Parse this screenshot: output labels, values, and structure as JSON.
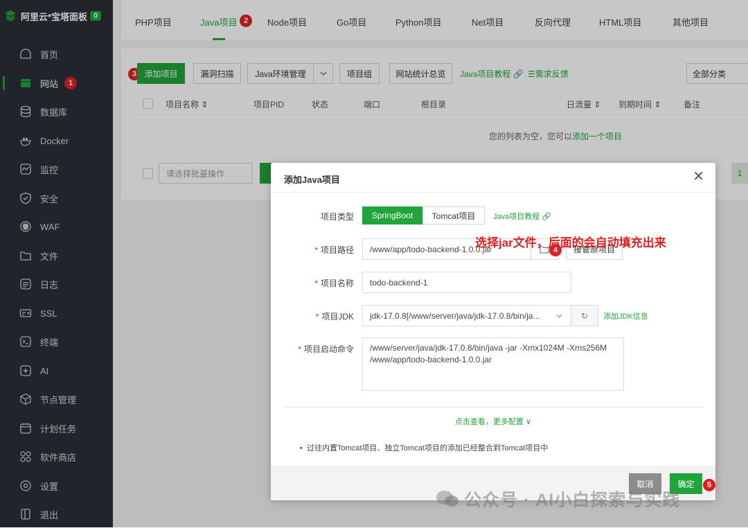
{
  "sidebar": {
    "brand": "阿里云*宝塔面板",
    "brand_count": "0",
    "items": [
      {
        "label": "首页",
        "icon": "home-icon"
      },
      {
        "label": "网站",
        "icon": "website-icon",
        "badge": "1"
      },
      {
        "label": "数据库",
        "icon": "database-icon"
      },
      {
        "label": "Docker",
        "icon": "docker-icon"
      },
      {
        "label": "监控",
        "icon": "monitor-icon"
      },
      {
        "label": "安全",
        "icon": "shield-icon"
      },
      {
        "label": "WAF",
        "icon": "waf-icon"
      },
      {
        "label": "文件",
        "icon": "folder-icon"
      },
      {
        "label": "日志",
        "icon": "log-icon"
      },
      {
        "label": "SSL",
        "icon": "ssl-icon"
      },
      {
        "label": "终端",
        "icon": "terminal-icon"
      },
      {
        "label": "AI",
        "icon": "ai-icon"
      },
      {
        "label": "节点管理",
        "icon": "node-icon"
      },
      {
        "label": "计划任务",
        "icon": "calendar-icon"
      },
      {
        "label": "软件商店",
        "icon": "store-icon"
      },
      {
        "label": "设置",
        "icon": "gear-icon"
      },
      {
        "label": "退出",
        "icon": "logout-icon"
      }
    ]
  },
  "tabs": [
    "PHP项目",
    "Java项目",
    "Node项目",
    "Go项目",
    "Python项目",
    "Net项目",
    "反向代理",
    "HTML项目",
    "其他项目"
  ],
  "tab_badge": "2",
  "toolbar": {
    "add_project": "添加项目",
    "add_badge": "3",
    "vuln_scan": "漏洞扫描",
    "java_env": "Java环境管理",
    "project_group": "项目组",
    "site_stats": "网站统计总览",
    "java_tutorial": "Java项目教程",
    "feedback": "需求反馈",
    "category": "全部分类"
  },
  "table": {
    "headers": [
      "项目名称",
      "项目PID",
      "状态",
      "端口",
      "根目录",
      "日流量",
      "到期时间",
      "备注"
    ],
    "empty_text": "您的列表为空，您可以",
    "empty_link": "添加一个项目",
    "batch_placeholder": "请选择批量操作",
    "page_num": "1"
  },
  "dialog": {
    "title": "添加Java项目",
    "type_label": "项目类型",
    "type_springboot": "SpringBoot",
    "type_tomcat": "Tomcat项目",
    "tutorial_link": "Java项目教程",
    "path_label": "项目路径",
    "path_value": "/www/app/todo-backend-1.0.0.jar",
    "path_badge": "4",
    "takeover_btn": "接管原项目",
    "name_label": "项目名称",
    "name_value": "todo-backend-1",
    "jdk_label": "项目JDK",
    "jdk_value": "jdk-17.0.8[/www/server/java/jdk-17.0.8/bin/ja...",
    "add_jdk": "添加JDK信息",
    "cmd_label": "项目启动命令",
    "cmd_value": "/www/server/java/jdk-17.0.8/bin/java -jar  -Xmx1024M -Xms256M /www/app/todo-backend-1.0.0.jar",
    "more_config": "点击查看，更多配置",
    "note": "过往内置Tomcat项目、独立Tomcat项目的添加已经整合到Tomcat项目中",
    "cancel": "取消",
    "confirm": "确定",
    "confirm_badge": "5"
  },
  "annotation": "选择jar文件，后面的会自动填充出来",
  "watermark": "公众号 · AI小白探索与实践",
  "colors": {
    "accent": "#20a53a",
    "sidebar": "#2b2f36",
    "badge": "#e02020"
  }
}
